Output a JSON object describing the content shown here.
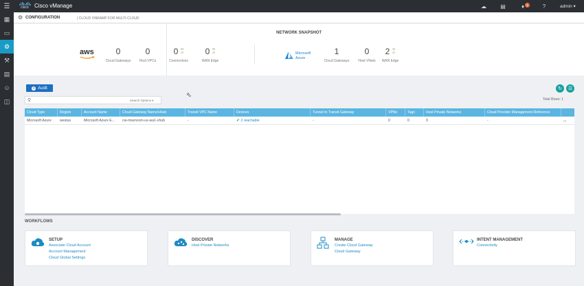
{
  "topbar": {
    "logo_text": "cisco",
    "app_title": "Cisco vManage",
    "notification_count": "1",
    "user": "admin"
  },
  "header": {
    "title": "CONFIGURATION",
    "subtitle": "CLOUD ONRAMP FOR MULTI-CLOUD"
  },
  "snapshot": {
    "title": "NETWORK SNAPSHOT",
    "aws": {
      "logo": "aws",
      "stats": [
        {
          "value": "0",
          "label": "Cloud Gateways"
        },
        {
          "value": "0",
          "label": "Host VPCs"
        },
        {
          "value": "0",
          "label": "Connections",
          "up": "0",
          "down": "0"
        },
        {
          "value": "0",
          "label": "WAN Edge",
          "up": "0",
          "down": "0"
        }
      ]
    },
    "azure": {
      "logo_line1": "Microsoft",
      "logo_line2": "Azure",
      "stats": [
        {
          "value": "1",
          "label": "Cloud Gateways"
        },
        {
          "value": "0",
          "label": "Host VNets"
        },
        {
          "value": "2",
          "label": "WAN Edge",
          "up": "2",
          "down": "0"
        }
      ]
    }
  },
  "actions": {
    "audit_label": "Audit",
    "search_placeholder": "",
    "search_options": "Search Options",
    "total_rows": "Total Rows: 1"
  },
  "table": {
    "columns": [
      "Cloud Type",
      "Region",
      "Account Name",
      "Cloud Gateway Name/vHub",
      "Transit VPC Name",
      "Devices",
      "Tunnel to Transit Gateway",
      "VPNs",
      "Tags",
      "Host Private Networks",
      "Cloud Provider Management Reference"
    ],
    "rows": [
      [
        "Microsoft Azure",
        "westus",
        "Microsoft Azure E...",
        "cw-msencom-us-wa1-vhub",
        "-",
        "2 reachable",
        "-",
        "0",
        "0",
        "0",
        "-"
      ]
    ],
    "row_menu": "..."
  },
  "workflows": {
    "label": "WORKFLOWS",
    "cards": [
      {
        "title": "SETUP",
        "links": [
          "Associate Cloud Account",
          "Account Management",
          "Cloud Global Settings"
        ],
        "icon": "cloud-gear-icon"
      },
      {
        "title": "DISCOVER",
        "links": [
          "Host Private Networks"
        ],
        "icon": "cloud-network-icon"
      },
      {
        "title": "MANAGE",
        "links": [
          "Create Cloud Gateway",
          "Cloud Gateway"
        ],
        "icon": "hierarchy-icon"
      },
      {
        "title": "INTENT MANAGEMENT",
        "links": [
          "Connectivity"
        ],
        "icon": "connectivity-icon"
      }
    ]
  },
  "colors": {
    "accent": "#1a9bc6",
    "table_header": "#5bb5e1",
    "link": "#1e8bc3",
    "button": "#1e6fc0"
  }
}
